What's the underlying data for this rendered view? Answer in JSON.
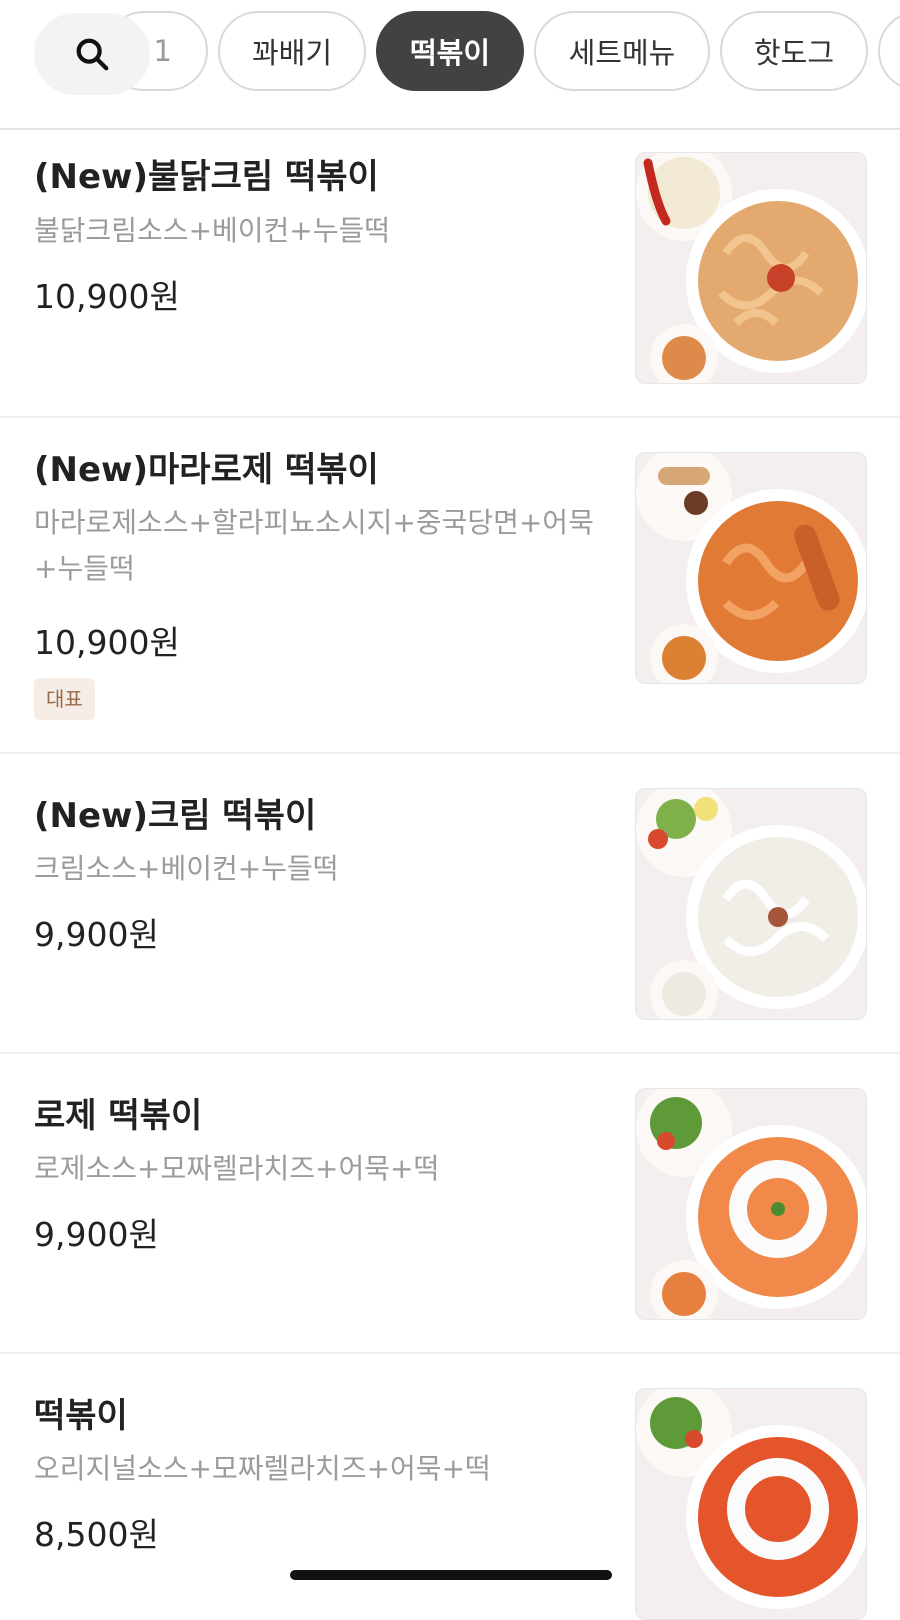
{
  "categories": {
    "partial_label": "1",
    "items": [
      {
        "label": "꽈배기"
      },
      {
        "label": "떡볶이",
        "active": true
      },
      {
        "label": "세트메뉴"
      },
      {
        "label": "핫도그"
      }
    ]
  },
  "menu": [
    {
      "name": "(New)불닭크림 떡볶이",
      "desc": "불닭크림소스+베이컨+누들떡",
      "price": "10,900원",
      "sauce": "cream-orange"
    },
    {
      "name": "(New)마라로제 떡볶이",
      "desc": "마라로제소스+할라피뇨소시지+중국당면+어묵+누들떡",
      "price": "10,900원",
      "badge": "대표",
      "sauce": "orange"
    },
    {
      "name": "(New)크림 떡볶이",
      "desc": "크림소스+베이컨+누들떡",
      "price": "9,900원",
      "sauce": "white"
    },
    {
      "name": "로제 떡볶이",
      "desc": "로제소스+모짜렐라치즈+어묵+떡",
      "price": "9,900원",
      "sauce": "rose"
    },
    {
      "name": "떡볶이",
      "desc": "오리지널소스+모짜렐라치즈+어묵+떡",
      "price": "8,500원",
      "sauce": "red"
    }
  ],
  "colors": {
    "active_chip": "#424242",
    "badge_bg": "#f6ede6",
    "badge_text": "#9a6a48"
  }
}
